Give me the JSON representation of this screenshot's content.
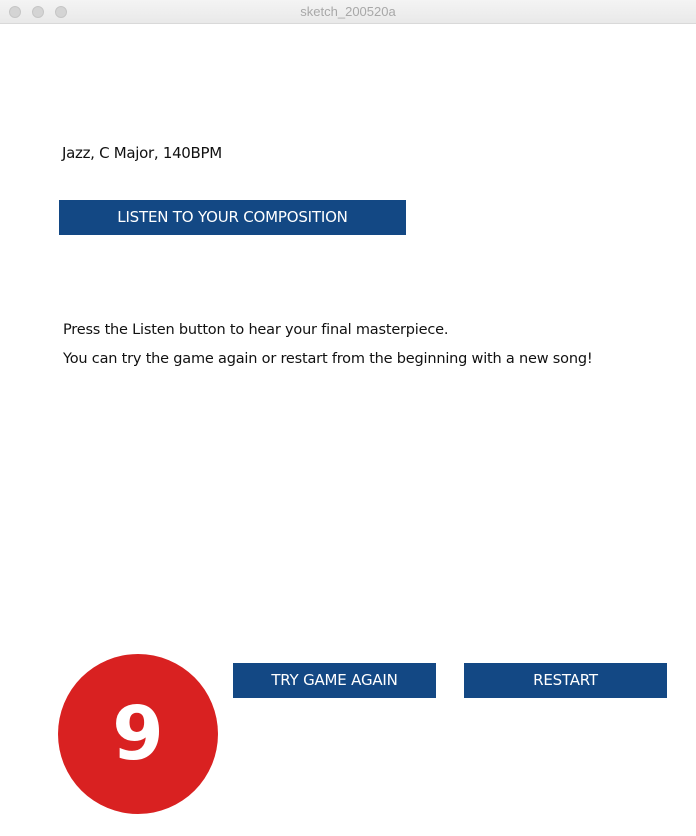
{
  "window": {
    "title": "sketch_200520a"
  },
  "composition": {
    "info": "Jazz, C Major, 140BPM",
    "listen_button": "LISTEN TO YOUR COMPOSITION"
  },
  "instructions": {
    "line1": "Press the Listen button to hear your final masterpiece.",
    "line2": "You can try the game again or restart from the beginning with a new song!"
  },
  "actions": {
    "try_again_button": "TRY GAME AGAIN",
    "restart_button": "RESTART"
  },
  "badge": {
    "number": "9"
  },
  "colors": {
    "button_bg": "#134884",
    "badge_bg": "#d92121",
    "text": "#111111"
  }
}
